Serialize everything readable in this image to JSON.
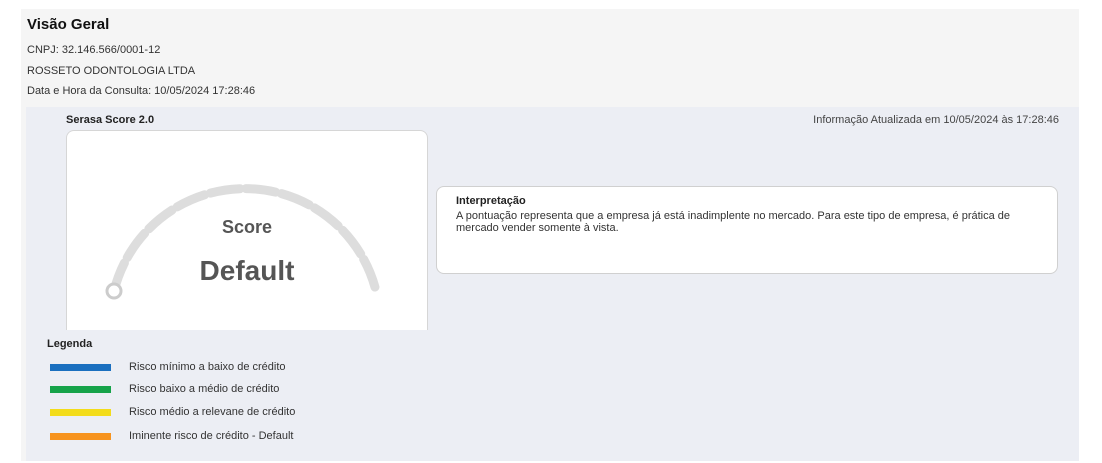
{
  "header": {
    "title": "Visão Geral",
    "cnpj": "CNPJ: 32.146.566/0001-12",
    "company": "ROSSETO ODONTOLOGIA LTDA",
    "consult_datetime": "Data e Hora da Consulta: 10/05/2024 17:28:46"
  },
  "score": {
    "section_title": "Serasa Score 2.0",
    "updated_text": "Informação Atualizada em 10/05/2024 às 17:28:46",
    "gauge_label": "Score",
    "gauge_value": "Default"
  },
  "interpretation": {
    "title": "Interpretação",
    "text": "A pontuação representa que a empresa já está inadimplente no mercado. Para este tipo de empresa, é prática de mercado vender somente à vista."
  },
  "legend": {
    "title": "Legenda",
    "items": [
      {
        "label": "Risco mínimo a baixo de crédito",
        "color": "#1a6fbf"
      },
      {
        "label": "Risco baixo a médio de crédito",
        "color": "#16a34a"
      },
      {
        "label": "Risco médio a relevane de crédito",
        "color": "#f3dc1a"
      },
      {
        "label": "Iminente risco de crédito - Default",
        "color": "#f7931e"
      }
    ]
  },
  "colors": {
    "gauge_track": "#dddddd",
    "gauge_marker_stroke": "#cccccc"
  }
}
